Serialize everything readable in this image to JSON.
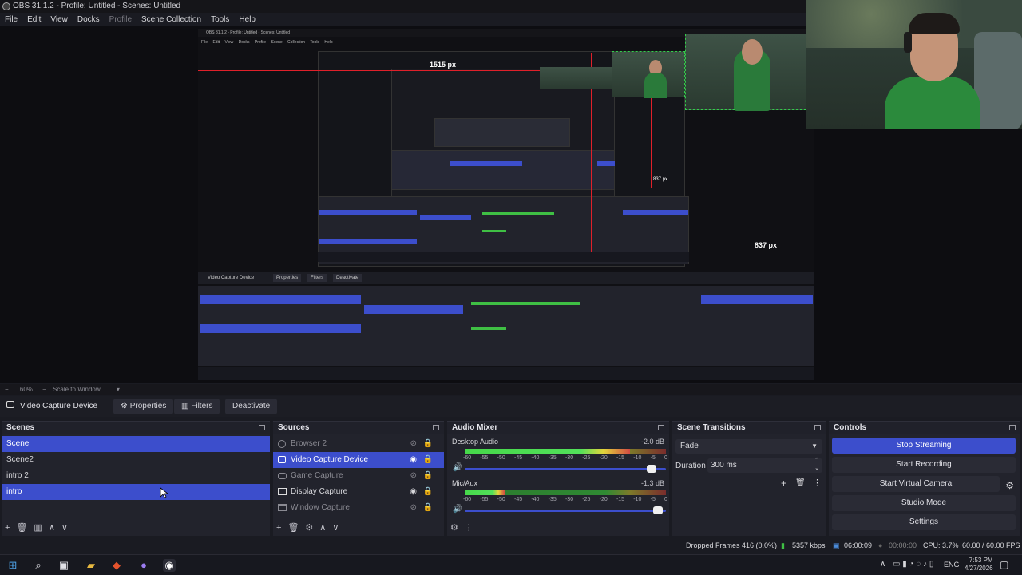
{
  "window": {
    "title": "OBS 31.1.2 - Profile: Untitled - Scenes: Untitled"
  },
  "menu": [
    "File",
    "Edit",
    "View",
    "Docks",
    "Profile",
    "Scene Collection",
    "Tools",
    "Help"
  ],
  "preview": {
    "nested_title": "OBS 31.1.2 - Profile: Untitled - Scenes: Untitled",
    "nested_menu": [
      "File",
      "Edit",
      "View",
      "Docks",
      "Profile",
      "Scene Collection",
      "Tools",
      "Help"
    ],
    "measure_top": "1515 px",
    "measure_right": "837 px",
    "measure_right2": "837 px"
  },
  "zoom": {
    "level": "60%",
    "scale_label": "Scale to Window"
  },
  "source_toolbar": {
    "source_name": "Video Capture Device",
    "properties": "Properties",
    "filters": "Filters",
    "deactivate": "Deactivate"
  },
  "scenes": {
    "title": "Scenes",
    "items": [
      {
        "label": "Scene",
        "selected": true
      },
      {
        "label": "Scene2",
        "selected": false
      },
      {
        "label": "intro 2",
        "selected": false
      },
      {
        "label": "intro",
        "selected": true
      }
    ]
  },
  "sources": {
    "title": "Sources",
    "items": [
      {
        "label": "Browser 2",
        "icon": "browser-icon",
        "visible": false,
        "selected": false
      },
      {
        "label": "Video Capture Device",
        "icon": "camera-icon",
        "visible": true,
        "selected": true
      },
      {
        "label": "Game Capture",
        "icon": "gamepad-icon",
        "visible": false,
        "selected": false
      },
      {
        "label": "Display Capture",
        "icon": "monitor-icon",
        "visible": true,
        "selected": false
      },
      {
        "label": "Window Capture",
        "icon": "window-icon",
        "visible": false,
        "selected": false
      }
    ]
  },
  "mixer": {
    "title": "Audio Mixer",
    "channels": [
      {
        "name": "Desktop Audio",
        "db": "-2.0 dB",
        "level": 0.82,
        "volume": 0.93
      },
      {
        "name": "Mic/Aux",
        "db": "-1.3 dB",
        "level": 0.2,
        "volume": 0.96
      }
    ],
    "ticks": [
      "-60",
      "-55",
      "-50",
      "-45",
      "-40",
      "-35",
      "-30",
      "-25",
      "-20",
      "-15",
      "-10",
      "-5",
      "0"
    ]
  },
  "transitions": {
    "title": "Scene Transitions",
    "selected": "Fade",
    "duration_label": "Duration",
    "duration_value": "300 ms"
  },
  "controls": {
    "title": "Controls",
    "stop_streaming": "Stop Streaming",
    "start_recording": "Start Recording",
    "start_virtual_camera": "Start Virtual Camera",
    "studio_mode": "Studio Mode",
    "settings": "Settings"
  },
  "status": {
    "dropped": "Dropped Frames 416 (0.0%)",
    "bitrate": "5357 kbps",
    "stream_time": "06:00:09",
    "rec_time": "00:00:00",
    "cpu": "CPU: 3.7%",
    "fps": "60.00 / 60.00 FPS"
  },
  "taskbar": {
    "lang": "ENG",
    "time": "7:53 PM",
    "date": "4/27/2026"
  },
  "colors": {
    "accent": "#3c4ecc",
    "record_red": "#e0202a",
    "panel": "#22232c"
  }
}
